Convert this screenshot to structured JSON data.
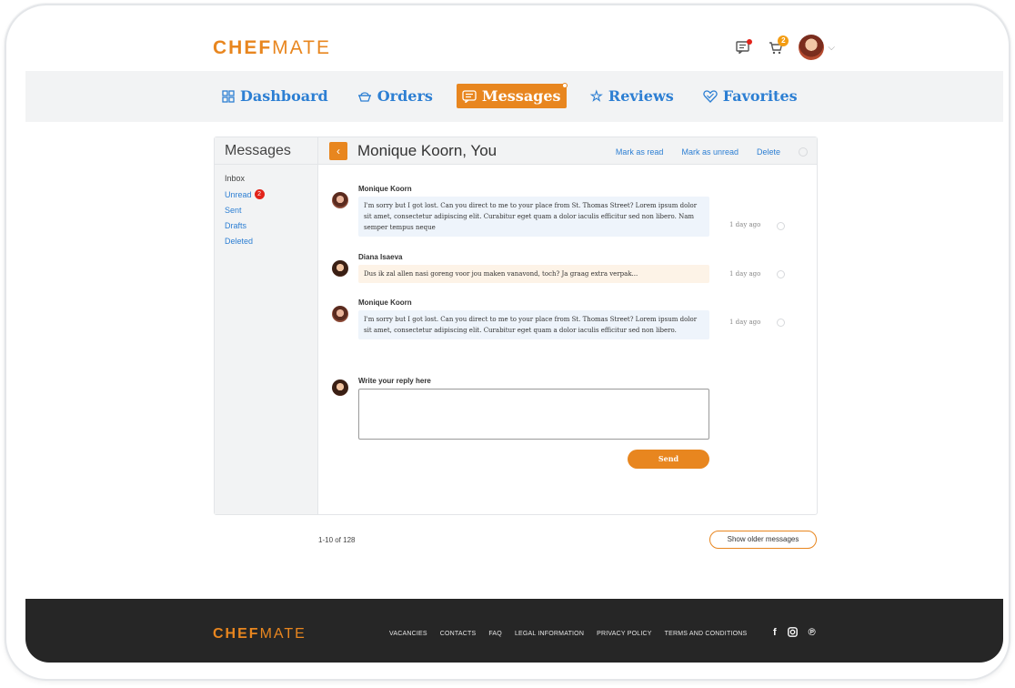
{
  "brand": {
    "logo_bold": "CHEF",
    "logo_light": "MATE"
  },
  "topbar": {
    "cart_count": "2"
  },
  "nav": [
    {
      "icon": "dashboard-icon",
      "label": "Dashboard"
    },
    {
      "icon": "orders-icon",
      "label": "Orders"
    },
    {
      "icon": "message-icon",
      "label": "Messages"
    },
    {
      "icon": "star-icon",
      "label": "Reviews"
    },
    {
      "icon": "heart-icon",
      "label": "Favorites"
    }
  ],
  "sidebar": {
    "title": "Messages",
    "items": [
      {
        "label": "Inbox"
      },
      {
        "label": "Unread",
        "badge": "2"
      },
      {
        "label": "Sent"
      },
      {
        "label": "Drafts"
      },
      {
        "label": "Deleted"
      }
    ]
  },
  "conversation": {
    "title": "Monique Koorn, You",
    "actions": {
      "mark_read": "Mark as read",
      "mark_unread": "Mark as unread",
      "delete": "Delete"
    },
    "messages": [
      {
        "author": "Monique Koorn",
        "text": "I'm sorry but I got lost. Can you direct to me to your place from St. Thomas Street? Lorem ipsum dolor sit amet, consectetur adipiscing elit. Curabitur eget quam a dolor iaculis efficitur sed non libero. Nam semper tempus neque",
        "time": "1 day ago"
      },
      {
        "author": "Diana Isaeva",
        "text": "Dus ik zal allen nasi goreng voor jou maken vanavond, toch? Ja graag extra verpak...",
        "time": "1 day ago"
      },
      {
        "author": "Monique Koorn",
        "text": "I'm sorry but I got lost. Can you direct to me to your place from St. Thomas Street? Lorem ipsum dolor sit amet, consectetur adipiscing elit. Curabitur eget quam a dolor iaculis efficitur sed non libero.",
        "time": "1 day ago"
      }
    ],
    "reply_label": "Write your reply here",
    "reply_value": "",
    "send_label": "Send"
  },
  "pagination": {
    "count": "1-10 of 128",
    "older_label": "Show older messages"
  },
  "footer": {
    "links": [
      "VACANCIES",
      "CONTACTS",
      "FAQ",
      "LEGAL INFORMATION",
      "PRIVACY POLICY",
      "TERMS AND CONDITIONS"
    ],
    "social": [
      "facebook-icon",
      "instagram-icon",
      "pinterest-icon"
    ]
  },
  "colors": {
    "accent": "#e8861f",
    "link": "#2d7fd3",
    "footer_bg": "#262626",
    "badge_red": "#e2231a"
  }
}
